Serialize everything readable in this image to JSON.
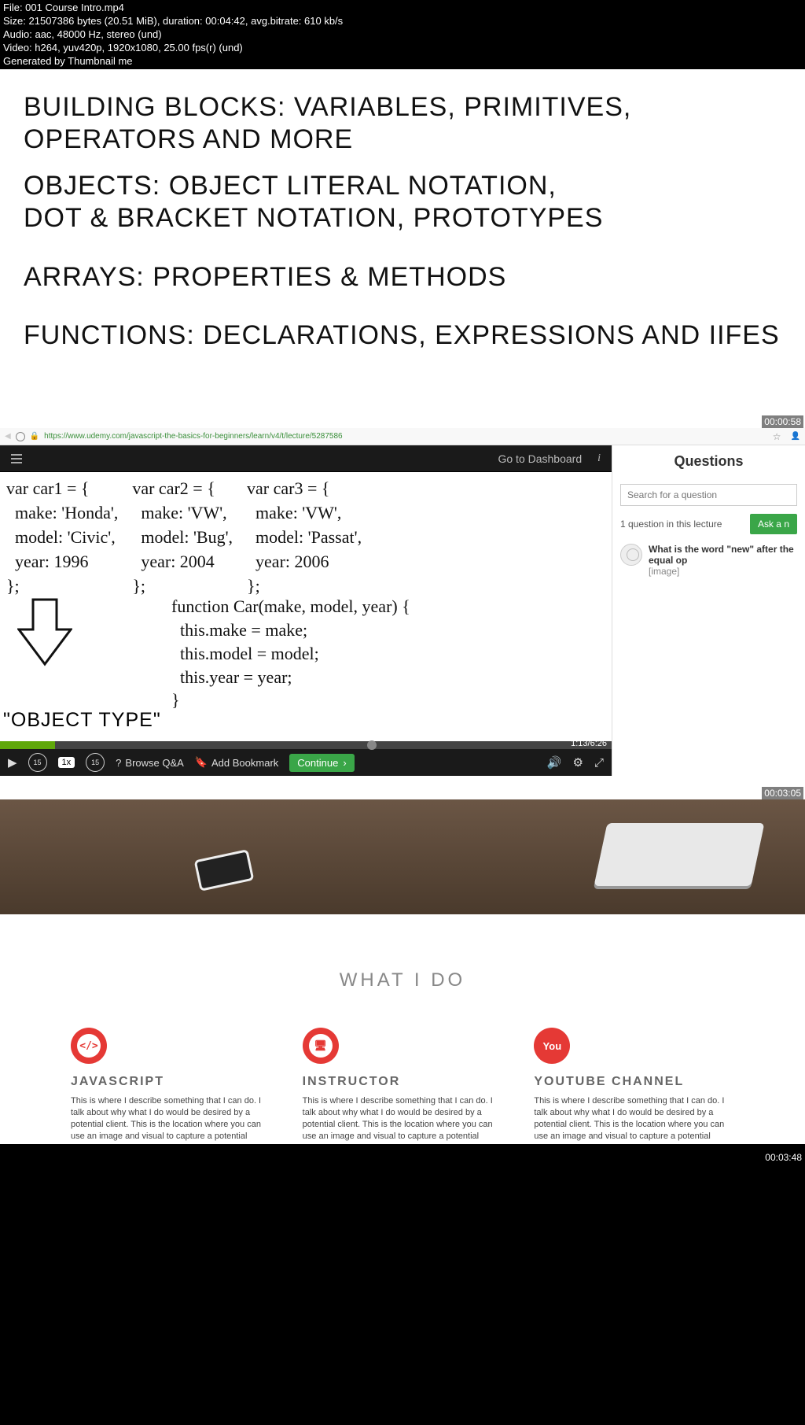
{
  "meta": {
    "file": "File: 001 Course Intro.mp4",
    "size": "Size: 21507386 bytes (20.51 MiB), duration: 00:04:42, avg.bitrate: 610 kb/s",
    "audio": "Audio: aac, 48000 Hz, stereo (und)",
    "video": "Video: h264, yuv420p, 1920x1080, 25.00 fps(r) (und)",
    "gen": "Generated by Thumbnail me"
  },
  "slide1": {
    "l1": "BUILDING BLOCKS: VARIABLES, PRIMITIVES, OPERATORS AND MORE",
    "l2": "OBJECTS: OBJECT LITERAL NOTATION, DOT & BRACKET NOTATION, PROTOTYPES",
    "l3": "ARRAYS: PROPERTIES & METHODS",
    "l4": "FUNCTIONS: DECLARATIONS, EXPRESSIONS AND IIFES",
    "ts": "00:00:58"
  },
  "slide2": {
    "url": "https://www.udemy.com/javascript-the-basics-for-beginners/learn/v4/t/lecture/5287586",
    "dashboard": "Go to Dashboard",
    "info": "i",
    "car1": "var car1 = {\n  make: 'Honda',\n  model: 'Civic',\n  year: 1996\n};",
    "car2": "var car2 = {\n  make: 'VW',\n  model: 'Bug',\n  year: 2004\n};",
    "car3": "var car3 = {\n  make: 'VW',\n  model: 'Passat',\n  year: 2006\n};",
    "func": "function Car(make, model, year) {\n  this.make = make;\n  this.model = model;\n  this.year = year;\n}",
    "object_type": "\"OBJECT TYPE\"",
    "progress_time": "1:13/6:26",
    "speed": "1x",
    "rewind": "15",
    "forward": "15",
    "browse": "Browse Q&A",
    "bookmark": "Add Bookmark",
    "continue": "Continue",
    "panel": {
      "title": "Questions",
      "search_ph": "Search for a question",
      "count": "1 question in this lecture",
      "ask": "Ask a n",
      "q_title": "What is the word \"new\" after the equal op",
      "q_sub": "[image]"
    },
    "ts": "00:03:05"
  },
  "slide3": {
    "heading": "WHAT I DO",
    "cols": [
      {
        "icon": "</>",
        "title": "JAVASCRIPT"
      },
      {
        "icon": "▭",
        "title": "INSTRUCTOR"
      },
      {
        "icon": "You",
        "title": "YOUTUBE CHANNEL"
      }
    ],
    "desc": "This is where I describe something that I can do. I talk about why what I do would be desired by a potential client. This is the location where you can use an image and visual to capture a potential customers purchase",
    "ts": "00:03:48"
  }
}
